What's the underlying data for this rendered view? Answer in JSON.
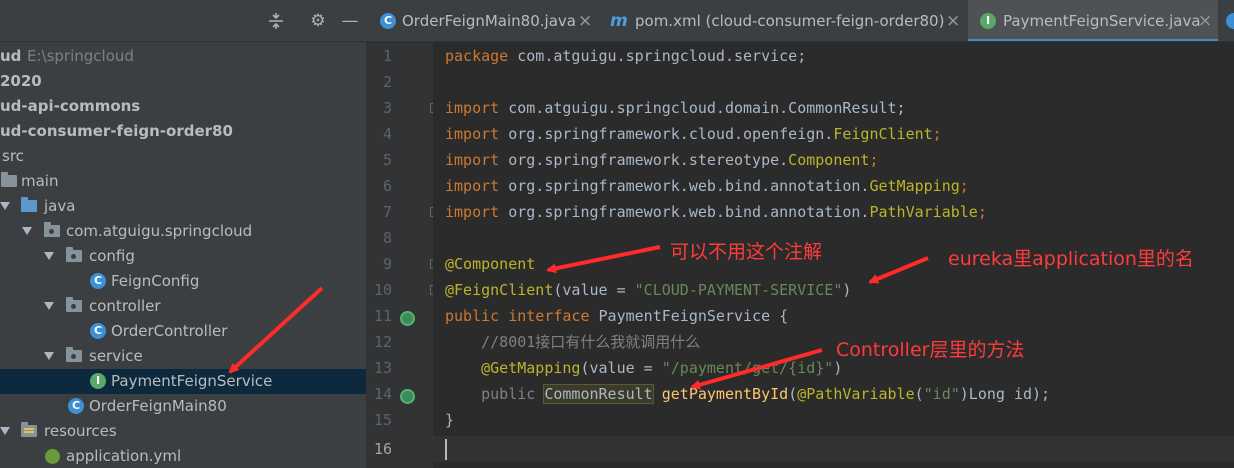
{
  "project_tree": {
    "root": {
      "label": "ud",
      "path": "E:\\springcloud"
    },
    "items": [
      {
        "label": "2020"
      },
      {
        "label": "ud-api-commons"
      },
      {
        "label": "ud-consumer-feign-order80"
      },
      {
        "label": "src"
      },
      {
        "label": "main"
      },
      {
        "label": "java"
      },
      {
        "label": "com.atguigu.springcloud"
      },
      {
        "label": "config"
      },
      {
        "label": "FeignConfig"
      },
      {
        "label": "controller"
      },
      {
        "label": "OrderController"
      },
      {
        "label": "service"
      },
      {
        "label": "PaymentFeignService"
      },
      {
        "label": "OrderFeignMain80"
      },
      {
        "label": "resources"
      },
      {
        "label": "application.yml"
      }
    ]
  },
  "tabs": [
    {
      "label": "OrderFeignMain80.java",
      "close": "×"
    },
    {
      "label": "pom.xml (cloud-consumer-feign-order80)",
      "close": "×"
    },
    {
      "label": "PaymentFeignService.java",
      "close": "×"
    }
  ],
  "gutter": {
    "lines": [
      "1",
      "2",
      "3",
      "4",
      "5",
      "6",
      "7",
      "8",
      "9",
      "10",
      "11",
      "12",
      "13",
      "14",
      "15",
      "16"
    ]
  },
  "code": {
    "l1_kw": "package",
    "l1_rest": " com.atguigu.springcloud.service;",
    "l3_kw": "import",
    "l3_rest": " com.atguigu.springcloud.domain.CommonResult;",
    "l4_kw": "import",
    "l4_a": " org.springframework.cloud.openfeign.",
    "l4_b": "FeignClient",
    "l4_c": ";",
    "l5_kw": "import",
    "l5_a": " org.springframework.stereotype.",
    "l5_b": "Component",
    "l5_c": ";",
    "l6_kw": "import",
    "l6_a": " org.springframework.web.bind.annotation.",
    "l6_b": "GetMapping",
    "l6_c": ";",
    "l7_kw": "import",
    "l7_a": " org.springframework.web.bind.annotation.",
    "l7_b": "PathVariable",
    "l7_c": ";",
    "l9_ann": "@Component",
    "l10_ann": "@FeignClient",
    "l10_a": "(value = ",
    "l10_str": "\"CLOUD-PAYMENT-SERVICE\"",
    "l10_b": ")",
    "l11_kw": "public interface",
    "l11_rest": " PaymentFeignService {",
    "l12_cmt": "//8001接口有什么我就调用什么",
    "l13_ann": "@GetMapping",
    "l13_a": "(value = ",
    "l13_str": "\"/payment/get/{id}\"",
    "l13_b": ")",
    "l14_kw": "public",
    "l14_type": "CommonResult",
    "l14_fn": "getPaymentById",
    "l14_a": "(",
    "l14_ann": "@PathVariable",
    "l14_b": "(",
    "l14_str": "\"id\"",
    "l14_c": ")Long id);",
    "l15": "}"
  },
  "annotations": {
    "note1": "可以不用这个注解",
    "note2": "eureka里application里的名",
    "note3": "Controller层里的方法"
  },
  "colors": {
    "keyword": "#cc7832",
    "annotation": "#bbb529",
    "string": "#6a8759",
    "comment": "#808080",
    "method": "#ffc66d",
    "annotation_note": "#ff3b3b",
    "selection": "#0d293e"
  },
  "icons": {
    "collapse": "collapse-all-icon",
    "settings": "gear-icon",
    "hide": "minus-icon"
  }
}
